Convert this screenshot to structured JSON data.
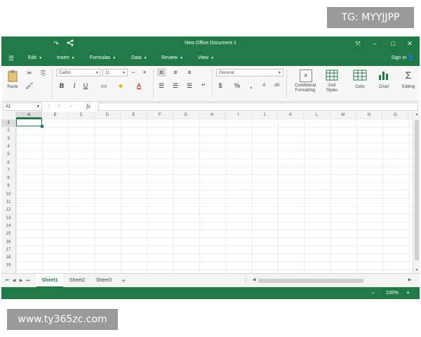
{
  "watermarks": {
    "top": "TG: MYYJJPP",
    "bottom": "www.ty365zc.com"
  },
  "window": {
    "title": "New Office Document 1"
  },
  "menu": {
    "items": [
      {
        "label": "Edit"
      },
      {
        "label": "Insert"
      },
      {
        "label": "Formulas"
      },
      {
        "label": "Data"
      },
      {
        "label": "Review"
      },
      {
        "label": "View"
      }
    ],
    "sign_in": "Sign In"
  },
  "ribbon": {
    "paste_label": "Paste",
    "font_name": "Calibri",
    "font_size": "11",
    "number_format": "General",
    "conditional_formatting_label": "Conditional Formatting",
    "cell_styles_label": "Cell Styles",
    "cells_label": "Cells",
    "chart_label": "Chart",
    "editing_label": "Editing"
  },
  "formula_bar": {
    "name_box": "A1",
    "fx": "fx",
    "value": ""
  },
  "grid": {
    "columns": [
      "A",
      "B",
      "C",
      "D",
      "E",
      "F",
      "G",
      "H",
      "I",
      "J",
      "K",
      "L",
      "M",
      "N",
      "O"
    ],
    "rows": [
      "1",
      "2",
      "3",
      "4",
      "5",
      "6",
      "7",
      "8",
      "9",
      "10",
      "11",
      "12",
      "13",
      "14",
      "15",
      "16",
      "17",
      "18",
      "19"
    ],
    "selected": "A1"
  },
  "sheets": {
    "tabs": [
      "Sheet1",
      "Sheet2",
      "Sheet3"
    ],
    "active": "Sheet1",
    "add": "+"
  },
  "status": {
    "zoom": "100%",
    "zoom_out": "−",
    "zoom_in": "+"
  },
  "colors": {
    "brand_green": "#1f7a45"
  }
}
